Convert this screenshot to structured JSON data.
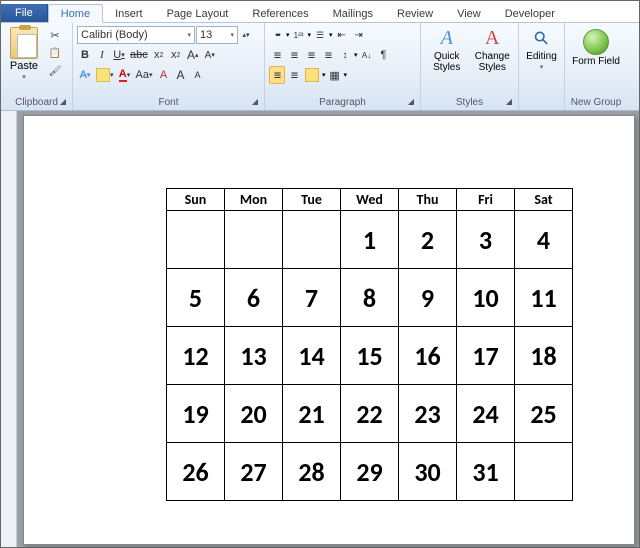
{
  "tabs": {
    "file": "File",
    "items": [
      "Home",
      "Insert",
      "Page Layout",
      "References",
      "Mailings",
      "Review",
      "View",
      "Developer"
    ],
    "active": "Home"
  },
  "ribbon": {
    "clipboard": {
      "paste": "Paste",
      "label": "Clipboard"
    },
    "font": {
      "name": "Calibri (Body)",
      "size": "13",
      "label": "Font",
      "bold": "B",
      "italic": "I",
      "underline": "U",
      "strike": "abc",
      "sub": "x",
      "sup": "x",
      "grow": "A",
      "shrink": "A",
      "case": "Aa",
      "clear": "A",
      "effects": "A",
      "highlight": "",
      "color": "A"
    },
    "paragraph": {
      "label": "Paragraph"
    },
    "styles": {
      "quick": "Quick Styles",
      "change": "Change Styles",
      "label": "Styles"
    },
    "editing": {
      "label": "Editing"
    },
    "newgroup": {
      "form": "Form Field",
      "label": "New Group"
    }
  },
  "calendar": {
    "days": [
      "Sun",
      "Mon",
      "Tue",
      "Wed",
      "Thu",
      "Fri",
      "Sat"
    ],
    "rows": [
      [
        "",
        "",
        "",
        "1",
        "2",
        "3",
        "4"
      ],
      [
        "5",
        "6",
        "7",
        "8",
        "9",
        "10",
        "11"
      ],
      [
        "12",
        "13",
        "14",
        "15",
        "16",
        "17",
        "18"
      ],
      [
        "19",
        "20",
        "21",
        "22",
        "23",
        "24",
        "25"
      ],
      [
        "26",
        "27",
        "28",
        "29",
        "30",
        "31",
        ""
      ]
    ]
  }
}
